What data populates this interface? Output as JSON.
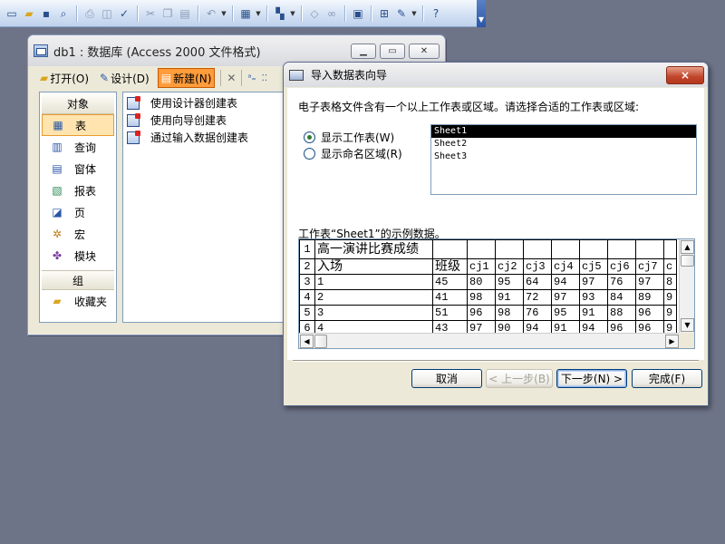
{
  "toolbar": {
    "icons": [
      "new-icon",
      "open-icon",
      "save-icon",
      "search-icon",
      "print-icon",
      "print-preview-icon",
      "spelling-icon",
      "cut-icon",
      "copy-icon",
      "paste-icon",
      "undo-icon",
      "office-links-icon",
      "analyze-icon",
      "code-icon",
      "script-icon",
      "properties-icon",
      "relationships-icon",
      "new-object-icon",
      "help-icon"
    ]
  },
  "db_window": {
    "title": "db1 : 数据库 (Access 2000 文件格式)",
    "toolbar": {
      "open": "打开(O)",
      "design": "设计(D)",
      "new": "新建(N)"
    },
    "objects_header": "对象",
    "objects": [
      {
        "label": "表",
        "icon": "table-icon",
        "selected": true
      },
      {
        "label": "查询",
        "icon": "query-icon"
      },
      {
        "label": "窗体",
        "icon": "form-icon"
      },
      {
        "label": "报表",
        "icon": "report-icon"
      },
      {
        "label": "页",
        "icon": "page-icon"
      },
      {
        "label": "宏",
        "icon": "macro-icon"
      },
      {
        "label": "模块",
        "icon": "module-icon"
      }
    ],
    "groups_header": "组",
    "groups": [
      {
        "label": "收藏夹",
        "icon": "favorites-icon"
      }
    ],
    "list_items": [
      "使用设计器创建表",
      "使用向导创建表",
      "通过输入数据创建表"
    ]
  },
  "wizard": {
    "title": "导入数据表向导",
    "close_label": "×",
    "description": "电子表格文件含有一个以上工作表或区域。请选择合适的工作表或区域:",
    "option_sheets": "显示工作表(W)",
    "option_ranges": "显示命名区域(R)",
    "sheets": [
      "Sheet1",
      "Sheet2",
      "Sheet3"
    ],
    "selected_sheet": "Sheet1",
    "sample_label": "工作表“Sheet1”的示例数据。",
    "grid": [
      [
        "1",
        "高一演讲比赛成绩",
        "",
        "",
        "",
        "",
        "",
        "",
        "",
        "",
        ""
      ],
      [
        "2",
        "入场",
        "班级",
        "cj1",
        "cj2",
        "cj3",
        "cj4",
        "cj5",
        "cj6",
        "cj7",
        "c"
      ],
      [
        "3",
        "1",
        "45",
        "80",
        "95",
        "64",
        "94",
        "97",
        "76",
        "97",
        "8"
      ],
      [
        "4",
        "2",
        "41",
        "98",
        "91",
        "72",
        "97",
        "93",
        "84",
        "89",
        "9"
      ],
      [
        "5",
        "3",
        "51",
        "96",
        "98",
        "76",
        "95",
        "91",
        "88",
        "96",
        "9"
      ],
      [
        "6",
        "4",
        "43",
        "97",
        "90",
        "94",
        "91",
        "94",
        "96",
        "96",
        "9"
      ]
    ],
    "buttons": {
      "cancel": "取消",
      "back": "< 上一步(B)",
      "next": "下一步(N) >",
      "finish": "完成(F)"
    }
  },
  "colors": {
    "desktop": "#6e7488",
    "dialog": "#ece9d8",
    "selection_orange": "#ff9c3c"
  }
}
